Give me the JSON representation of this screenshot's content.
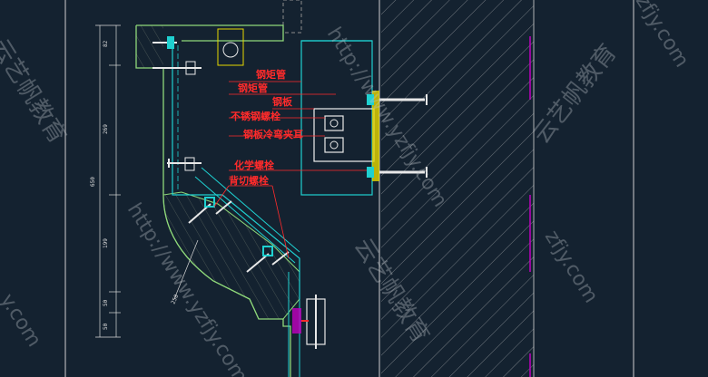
{
  "callouts": {
    "steel_tube_1": "钢矩管",
    "steel_tube_2": "钢矩管",
    "steel_plate": "钢板",
    "ss_bolt": "不锈钢螺栓",
    "angle_ear": "钢板冷弯夹耳",
    "chem_bolt": "化学螺栓",
    "undercut_anchor": "背切螺栓"
  },
  "dimensions": [
    "82",
    "269",
    "650",
    "199",
    "50",
    "50",
    "250"
  ],
  "watermarks": {
    "url": "http://www.yzfjy.com",
    "brand": "云艺帆教育",
    "url_short": "zfjy.com",
    "url_tail": "y.com"
  },
  "colors": {
    "background": "#142230",
    "concrete": "#8fd97a",
    "steel": "#1fd0d0",
    "label": "#ff2b2b",
    "divider": "#c000c0"
  }
}
